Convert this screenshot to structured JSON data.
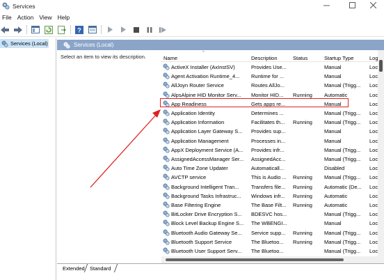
{
  "window": {
    "title": "Services"
  },
  "menu": [
    "File",
    "Action",
    "View",
    "Help"
  ],
  "tree": {
    "item": "Services (Local)"
  },
  "pane": {
    "header": "Services (Local)",
    "description": "Select an item to view its description."
  },
  "columns": {
    "name": "Name",
    "description": "Description",
    "status": "Status",
    "startup": "Startup Type",
    "log": "Log"
  },
  "services": [
    {
      "name": "ActiveX Installer (AxInstSV)",
      "description": "Provides Use...",
      "status": "",
      "startup": "Manual",
      "log": "Loc"
    },
    {
      "name": "Agent Activation Runtime_4...",
      "description": "Runtime for ...",
      "status": "",
      "startup": "Manual",
      "log": "Loc"
    },
    {
      "name": "AllJoyn Router Service",
      "description": "Routes AllJo...",
      "status": "",
      "startup": "Manual (Trigg...",
      "log": "Loc"
    },
    {
      "name": "AlpsAlpine HID Monitor Serv...",
      "description": "Monitor HID...",
      "status": "Running",
      "startup": "Automatic",
      "log": "Loc"
    },
    {
      "name": "App Readiness",
      "description": "Gets apps re...",
      "status": "",
      "startup": "Manual",
      "log": "Loc"
    },
    {
      "name": "Application Identity",
      "description": "Determines ...",
      "status": "",
      "startup": "Manual (Trigg...",
      "log": "Loc"
    },
    {
      "name": "Application Information",
      "description": "Facilitates th...",
      "status": "Running",
      "startup": "Manual (Trigg...",
      "log": "Loc"
    },
    {
      "name": "Application Layer Gateway S...",
      "description": "Provides sup...",
      "status": "",
      "startup": "Manual",
      "log": "Loc"
    },
    {
      "name": "Application Management",
      "description": "Processes in...",
      "status": "",
      "startup": "Manual",
      "log": "Loc"
    },
    {
      "name": "AppX Deployment Service (A...",
      "description": "Provides infr...",
      "status": "",
      "startup": "Manual (Trigg...",
      "log": "Loc"
    },
    {
      "name": "AssignedAccessManager Ser...",
      "description": "AssignedAcc...",
      "status": "",
      "startup": "Manual (Trigg...",
      "log": "Loc"
    },
    {
      "name": "Auto Time Zone Updater",
      "description": "Automaticall...",
      "status": "",
      "startup": "Disabled",
      "log": "Loc"
    },
    {
      "name": "AVCTP service",
      "description": "This is Audio ...",
      "status": "Running",
      "startup": "Manual (Trigg...",
      "log": "Loc"
    },
    {
      "name": "Background Intelligent Tran...",
      "description": "Transfers file...",
      "status": "Running",
      "startup": "Automatic (De...",
      "log": "Loc"
    },
    {
      "name": "Background Tasks Infrastruc...",
      "description": "Windows infr...",
      "status": "Running",
      "startup": "Automatic",
      "log": "Loc"
    },
    {
      "name": "Base Filtering Engine",
      "description": "The Base Filt...",
      "status": "Running",
      "startup": "Automatic",
      "log": "Loc"
    },
    {
      "name": "BitLocker Drive Encryption S...",
      "description": "BDESVC hos...",
      "status": "",
      "startup": "Manual (Trigg...",
      "log": "Loc"
    },
    {
      "name": "Block Level Backup Engine S...",
      "description": "The WBENGI...",
      "status": "",
      "startup": "Manual",
      "log": "Loc"
    },
    {
      "name": "Bluetooth Audio Gateway Se...",
      "description": "Service supp...",
      "status": "Running",
      "startup": "Manual (Trigg...",
      "log": "Loc"
    },
    {
      "name": "Bluetooth Support Service",
      "description": "The Bluetoo...",
      "status": "Running",
      "startup": "Manual (Trigg...",
      "log": "Loc"
    },
    {
      "name": "Bluetooth User Support Serv...",
      "description": "The Bluetoo...",
      "status": "",
      "startup": "Manual (Trigg...",
      "log": "Loc"
    }
  ],
  "tabs": [
    "Extended",
    "Standard"
  ],
  "colors": {
    "highlight": "#e02020",
    "arrow": "#e02020",
    "pane_header": "#8ba5c9",
    "selection": "#cce4f7"
  }
}
